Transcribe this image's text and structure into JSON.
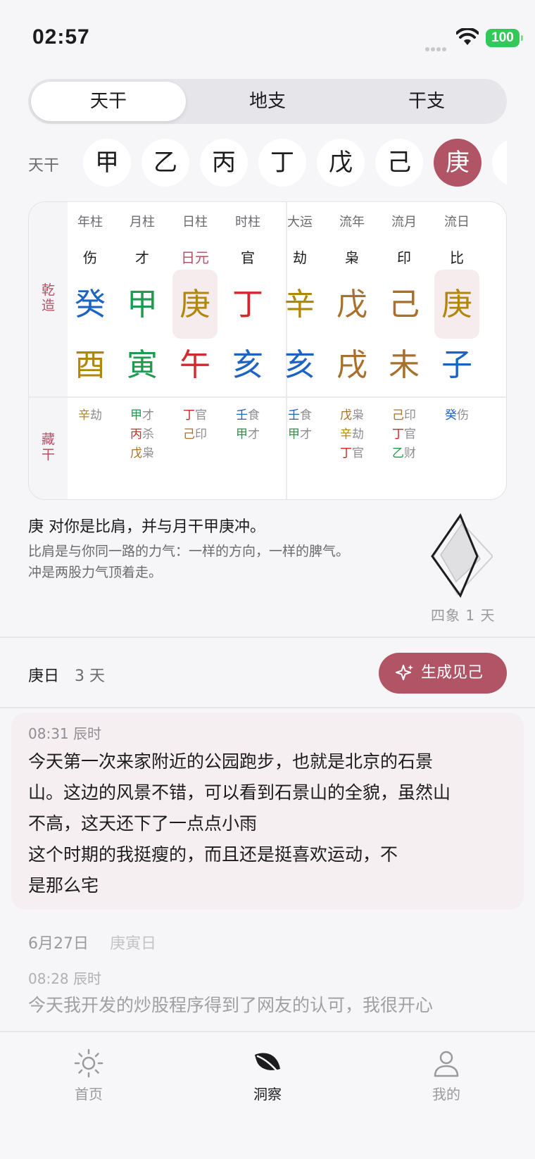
{
  "status_bar": {
    "time": "02:57",
    "battery": "100"
  },
  "segmented": {
    "tabs": [
      "天干",
      "地支",
      "干支"
    ],
    "active_index": 0
  },
  "stem_selector": {
    "label": "天干",
    "stems": [
      "甲",
      "乙",
      "丙",
      "丁",
      "戊",
      "己",
      "庚"
    ],
    "selected": "庚"
  },
  "chart": {
    "side_labels": {
      "qianzao": [
        "乾",
        "造"
      ],
      "canggan": [
        "藏",
        "干"
      ]
    },
    "columns": [
      {
        "header": "年柱",
        "role": "伤",
        "stem": "癸",
        "stem_color": "water",
        "branch": "酉",
        "branch_color": "metal",
        "hidden": [
          {
            "stem": "辛",
            "color": "metal",
            "role": "劫"
          }
        ]
      },
      {
        "header": "月柱",
        "role": "才",
        "stem": "甲",
        "stem_color": "wood",
        "branch": "寅",
        "branch_color": "wood",
        "hidden": [
          {
            "stem": "甲",
            "color": "wood",
            "role": "才"
          },
          {
            "stem": "丙",
            "color": "fire",
            "role": "杀"
          },
          {
            "stem": "戊",
            "color": "earth",
            "role": "枭"
          }
        ]
      },
      {
        "header": "日柱",
        "role": "日元",
        "stem": "庚",
        "stem_color": "metal",
        "branch": "午",
        "branch_color": "fire",
        "hidden": [
          {
            "stem": "丁",
            "color": "fire",
            "role": "官"
          },
          {
            "stem": "己",
            "color": "earth",
            "role": "印"
          }
        ]
      },
      {
        "header": "时柱",
        "role": "官",
        "stem": "丁",
        "stem_color": "fire",
        "branch": "亥",
        "branch_color": "water",
        "hidden": [
          {
            "stem": "壬",
            "color": "water",
            "role": "食"
          },
          {
            "stem": "甲",
            "color": "wood",
            "role": "才"
          }
        ]
      },
      {
        "header": "大运",
        "role": "劫",
        "stem": "辛",
        "stem_color": "metal",
        "branch": "亥",
        "branch_color": "water",
        "hidden": [
          {
            "stem": "壬",
            "color": "water",
            "role": "食"
          },
          {
            "stem": "甲",
            "color": "wood",
            "role": "才"
          }
        ]
      },
      {
        "header": "流年",
        "role": "枭",
        "stem": "戊",
        "stem_color": "earth",
        "branch": "戌",
        "branch_color": "earth",
        "hidden": [
          {
            "stem": "戊",
            "color": "earth",
            "role": "枭"
          },
          {
            "stem": "辛",
            "color": "metal",
            "role": "劫"
          },
          {
            "stem": "丁",
            "color": "fire",
            "role": "官"
          }
        ]
      },
      {
        "header": "流月",
        "role": "印",
        "stem": "己",
        "stem_color": "earth",
        "branch": "未",
        "branch_color": "earth",
        "hidden": [
          {
            "stem": "己",
            "color": "earth",
            "role": "印"
          },
          {
            "stem": "丁",
            "color": "fire",
            "role": "官"
          },
          {
            "stem": "乙",
            "color": "wood",
            "role": "财"
          }
        ]
      },
      {
        "header": "流日",
        "role": "比",
        "stem": "庚",
        "stem_color": "metal",
        "branch": "子",
        "branch_color": "water",
        "hidden": [
          {
            "stem": "癸",
            "color": "water",
            "role": "伤"
          }
        ]
      }
    ]
  },
  "explanation": {
    "title": "庚 对你是比肩，并与月干甲庚冲。",
    "lines": [
      "比肩是与你同一路的力气：一样的方向，一样的脾气。",
      "冲是两股力气顶着走。"
    ],
    "sixiang": "四象 1 天"
  },
  "day": {
    "label": "庚日",
    "count": "3 天",
    "generate_button": "生成见己"
  },
  "entries": [
    {
      "time": "08:31 辰时",
      "lines": [
        "今天第一次来家附近的公园跑步，也就是北京的石景",
        "山。这边的风景不错，可以看到石景山的全貌，虽然山",
        "不高，这天还下了一点点小雨",
        "这个时期的我挺瘦的，而且还是挺喜欢运动，不",
        "是那么宅"
      ]
    },
    {
      "date": "6月27日",
      "day": "庚寅日",
      "time": "08:28 辰时",
      "lines": [
        "今天我开发的炒股程序得到了网友的认可，我很开心"
      ]
    }
  ],
  "tab_bar": {
    "tabs": [
      "首页",
      "洞察",
      "我的"
    ],
    "active_index": 1
  },
  "colors": {
    "accent": "#b05466",
    "wood": "#1f9a4e",
    "fire": "#d22a2a",
    "earth": "#a8702c",
    "metal": "#b1870a",
    "water": "#1b64c4",
    "battery": "#34c759"
  }
}
